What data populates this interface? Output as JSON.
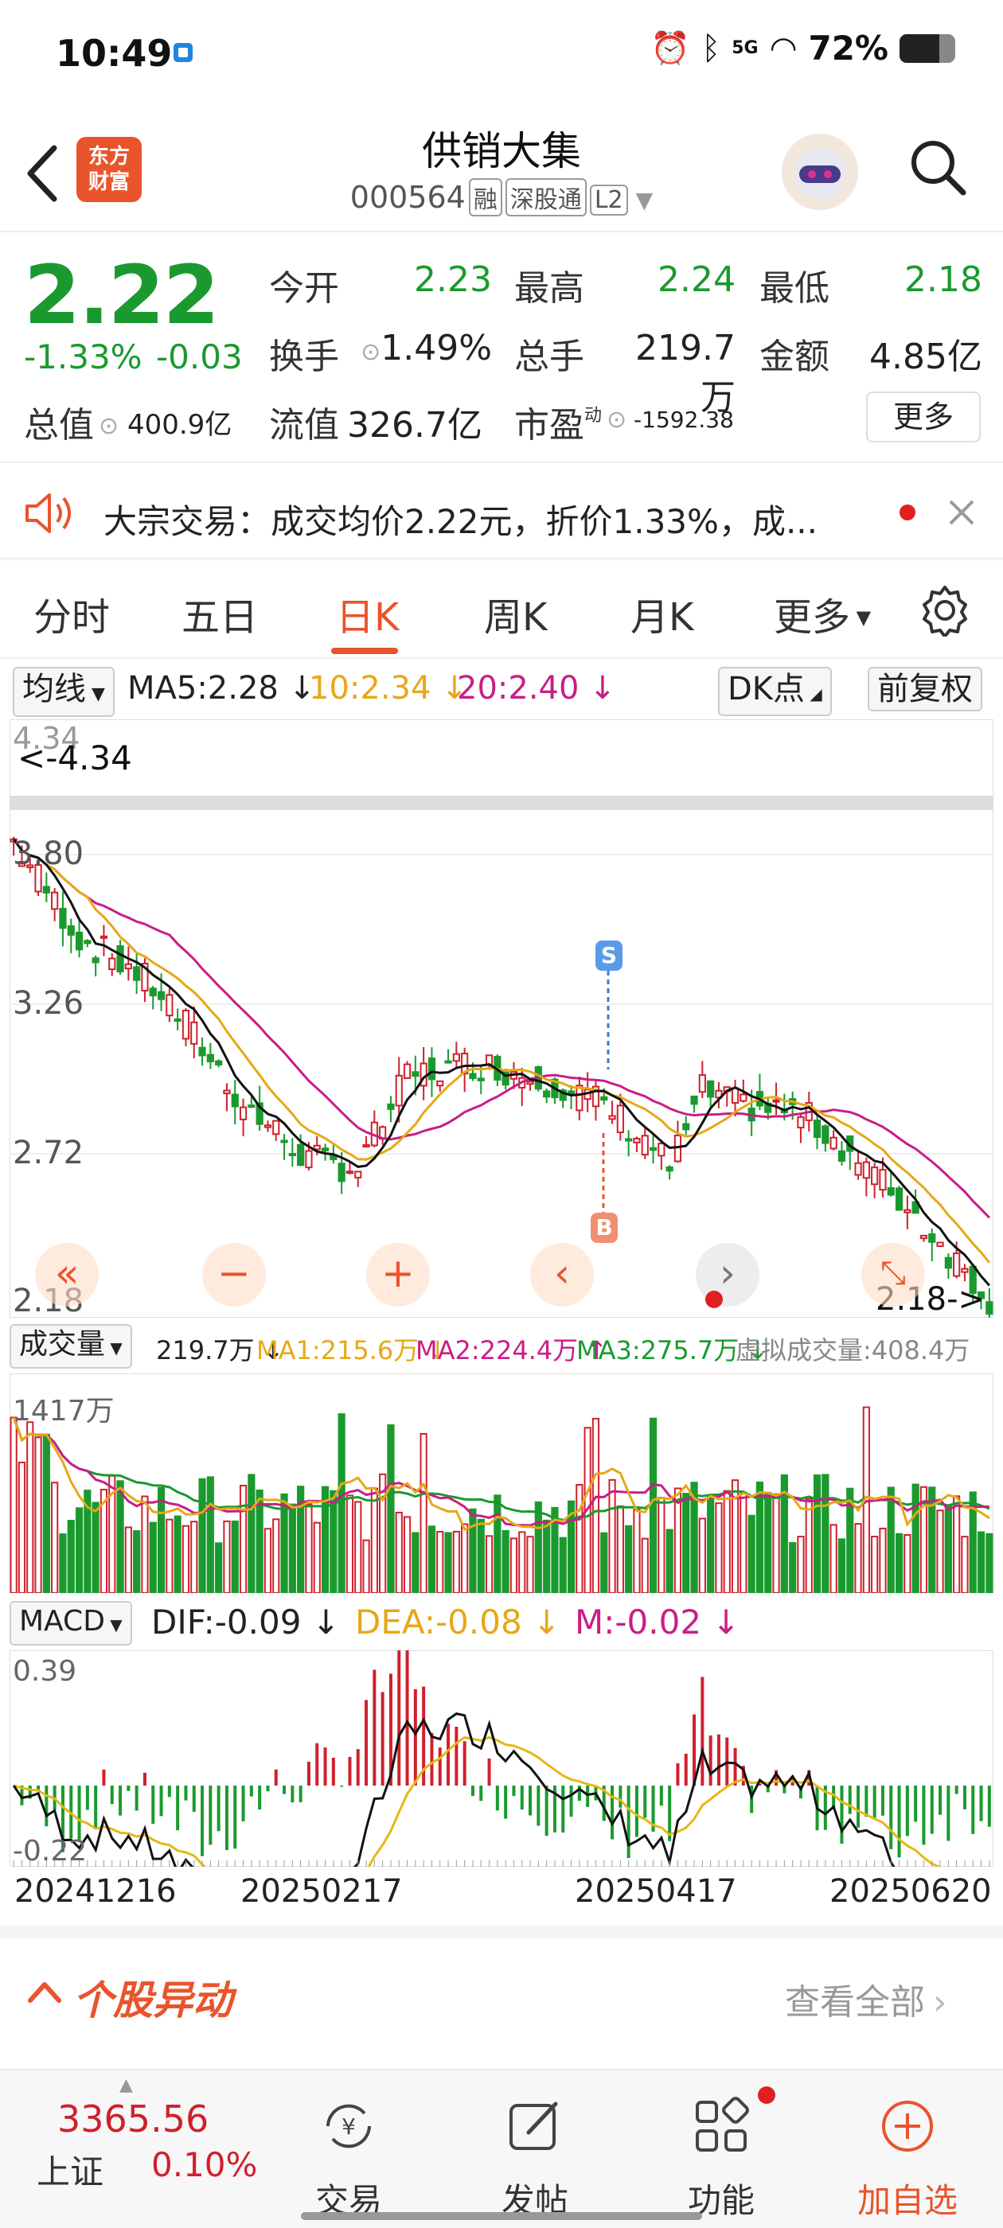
{
  "status": {
    "time": "10:49",
    "signal": "5G",
    "battery": "72%",
    "battery_level": 0.72
  },
  "header": {
    "logo_line1": "东方",
    "logo_line2": "财富",
    "stock_name": "供销大集",
    "stock_code": "000564",
    "tags": [
      "融",
      "深股通",
      "L2"
    ]
  },
  "quote": {
    "price": "2.22",
    "change_pct": "-1.33%",
    "change": "-0.03",
    "open_label": "今开",
    "open": "2.23",
    "high_label": "最高",
    "high": "2.24",
    "low_label": "最低",
    "low": "2.18",
    "turnover_label": "换手",
    "turnover": "1.49%",
    "volume_label": "总手",
    "volume": "219.7万",
    "amount_label": "金额",
    "amount": "4.85亿",
    "mcap_label": "总值",
    "mcap": "400.9亿",
    "float_label": "流值",
    "float": "326.7亿",
    "pe_label": "市盈",
    "pe_sup": "动",
    "pe": "-1592.38",
    "more": "更多"
  },
  "notice": {
    "text": "大宗交易：成交均价2.22元，折价1.33%，成..."
  },
  "tabs": [
    "分时",
    "五日",
    "日K",
    "周K",
    "月K",
    "更多"
  ],
  "active_tab": "日K",
  "kline": {
    "ma_selector": "均线",
    "ma5": "MA5:2.28 ↓",
    "ma10": "10:2.34 ↓",
    "ma20": "20:2.40 ↓",
    "dk_selector": "DK点",
    "adjust": "前复权",
    "y_max": "4.34",
    "y_max_marker": "<-4.34",
    "y_ticks": [
      "3.80",
      "3.26",
      "2.72",
      "2.18"
    ],
    "y_min_marker": "2.18->",
    "signal_s": "S",
    "signal_b": "B",
    "colors": {
      "up": "#d0202c",
      "down": "#1a9a2e",
      "ma5": "#111111",
      "ma10": "#e6a817",
      "ma20": "#c81e87"
    }
  },
  "volume": {
    "selector": "成交量",
    "value": "219.7万 ↓",
    "ma1": "MA1:215.6万 ↓",
    "ma2": "MA2:224.4万 ↑",
    "ma3": "MA3:275.7万 ↓",
    "virtual": "虚拟成交量:408.4万",
    "top": "1417万"
  },
  "macd": {
    "selector": "MACD",
    "dif": "DIF:-0.09 ↓",
    "dea": "DEA:-0.08 ↓",
    "m": "M:-0.02 ↓",
    "top": "0.39",
    "bottom": "-0.22"
  },
  "dates": [
    "20241216",
    "20250217",
    "20250417",
    "20250620"
  ],
  "section": {
    "title": "个股异动",
    "link": "查看全部"
  },
  "bottom_nav": {
    "index_value": "3365.56",
    "index_name": "上证",
    "index_change": "0.10%",
    "items": [
      "交易",
      "发帖",
      "功能",
      "加自选"
    ]
  }
}
